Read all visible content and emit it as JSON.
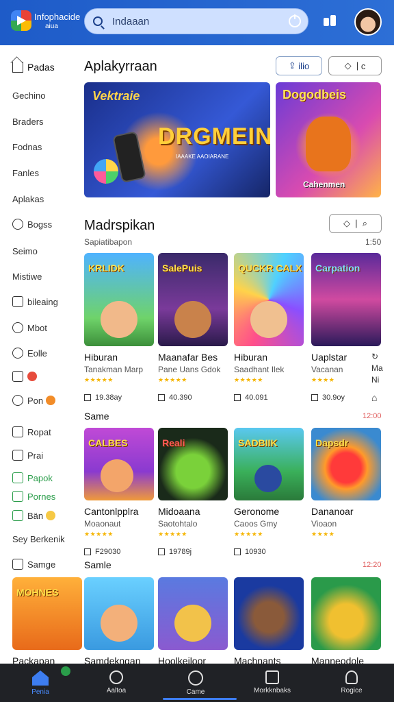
{
  "header": {
    "brand": "Infophacide",
    "brand_sub": "aiua",
    "search_placeholder": "Indaaan"
  },
  "sidebar": {
    "items": [
      {
        "label": "Padas",
        "icon": "home-icon"
      },
      {
        "label": "Gechino",
        "icon": ""
      },
      {
        "label": "Braders",
        "icon": ""
      },
      {
        "label": "Fodnas",
        "icon": ""
      },
      {
        "label": "Fanles",
        "icon": ""
      },
      {
        "label": "Aplakas",
        "icon": ""
      },
      {
        "label": "Bogss",
        "icon": "chat-icon"
      },
      {
        "label": "Seimo",
        "icon": ""
      },
      {
        "label": "Mistiwe",
        "icon": ""
      },
      {
        "label": "bileaing",
        "icon": "bookmark-icon"
      },
      {
        "label": "Mbot",
        "icon": "smile-icon"
      },
      {
        "label": "Eolle",
        "icon": "tag-icon"
      },
      {
        "label": "",
        "icon": "gift-icon"
      },
      {
        "label": "Pon",
        "icon": "coin-icon"
      },
      {
        "label": "Ropat",
        "icon": "box-icon"
      },
      {
        "label": "Prai",
        "icon": "note-icon"
      },
      {
        "label": "Papok",
        "icon": "check-icon"
      },
      {
        "label": "Pornes",
        "icon": "check-icon"
      },
      {
        "label": "Bän",
        "icon": "star-icon"
      },
      {
        "label": "Sey Berkenik",
        "icon": ""
      },
      {
        "label": "Samge",
        "icon": "mail-icon"
      }
    ]
  },
  "sections": {
    "featured": {
      "title": "Aplakyrraan",
      "chip_left": "ilio",
      "chip_right": "c",
      "banner_main": {
        "tagline": "Vektraie",
        "title": "DRGMEIN",
        "small": "IAAAKE AAOIARANE"
      },
      "banner_side": {
        "title": "Dogodbeis",
        "caption": "Cahenmen"
      }
    },
    "recommended": {
      "title": "Madrspikan",
      "subtitle": "Sapiatibapon",
      "count": "1:50",
      "cards": [
        {
          "tag": "KRLIDK",
          "name": "Hiburan",
          "dev": "Tanakman Marp",
          "stars": "★★★★★",
          "meta": "19.38ay"
        },
        {
          "tag": "SalePuis",
          "name": "Maanafar Bes",
          "dev": "Pane Uans Gdok",
          "stars": "★★★★★",
          "meta": "40.390"
        },
        {
          "tag": "QUCKR CALX",
          "name": "Hiburan",
          "dev": "Saadhant Ilek",
          "stars": "★★★★★",
          "meta": "40.091"
        },
        {
          "tag": "Carpation",
          "name": "Uaplstar",
          "dev": "Vacanan",
          "stars": "★★★★",
          "meta": "30.9oy"
        }
      ],
      "extra_cutoff": {
        "line1": "Ma",
        "line2": "Ni"
      }
    },
    "row_same": {
      "label": "Same",
      "count": "12:00",
      "cards": [
        {
          "tag": "CALBES",
          "name": "Cantonlpplra",
          "dev": "Moaonaut",
          "stars": "★★★★★",
          "meta": "F29030"
        },
        {
          "tag": "Reali",
          "name": "Midoaana",
          "dev": "Saotohtalo",
          "stars": "★★★★★",
          "meta": "19789j"
        },
        {
          "tag": "SADBIIK",
          "name": "Geronome",
          "dev": "Caoos Gmy",
          "stars": "★★★★★",
          "meta": "10930"
        },
        {
          "tag": "Dapsdr",
          "name": "Dananoar",
          "dev": "Vioaon",
          "stars": "★★★★",
          "meta": ""
        }
      ]
    },
    "row_samle": {
      "label": "Samle",
      "count": "12:20",
      "cards": [
        {
          "tag": "MOHNES",
          "name": "Packapan"
        },
        {
          "tag": "",
          "name": "Samdekngan"
        },
        {
          "tag": "",
          "name": "Hoolkeiloor"
        },
        {
          "tag": "",
          "name": "Machnants"
        },
        {
          "tag": "",
          "name": "Manneodole"
        }
      ]
    }
  },
  "bottom_nav": [
    {
      "label": "Penia",
      "icon": "home-icon",
      "active": true
    },
    {
      "label": "Aaltoa",
      "icon": "search-icon"
    },
    {
      "label": "Came",
      "icon": "compass-icon"
    },
    {
      "label": "Morkknbaks",
      "icon": "library-icon"
    },
    {
      "label": "Rogice",
      "icon": "profile-icon"
    }
  ],
  "colors": {
    "header_bg": "#1e5bc8",
    "accent": "#3d7df0",
    "star": "#f5b400",
    "count_red": "#e06060",
    "bottom_bar": "#202226"
  }
}
